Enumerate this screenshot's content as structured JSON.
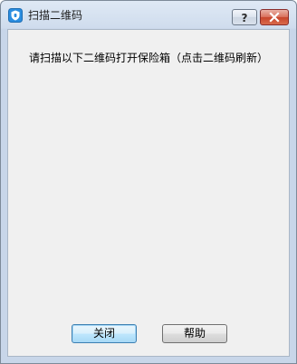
{
  "window": {
    "title": "扫描二维码"
  },
  "titlebar_buttons": {
    "help_icon": "question-mark-icon",
    "close_icon": "close-x-icon"
  },
  "content": {
    "instruction": "请扫描以下二维码打开保险箱（点击二维码刷新）"
  },
  "buttons": {
    "close_label": "关闭",
    "help_label": "帮助"
  },
  "colors": {
    "titlebar": "#cfdced",
    "close_accent": "#c8452b",
    "focus_border": "#3c7fb1"
  }
}
